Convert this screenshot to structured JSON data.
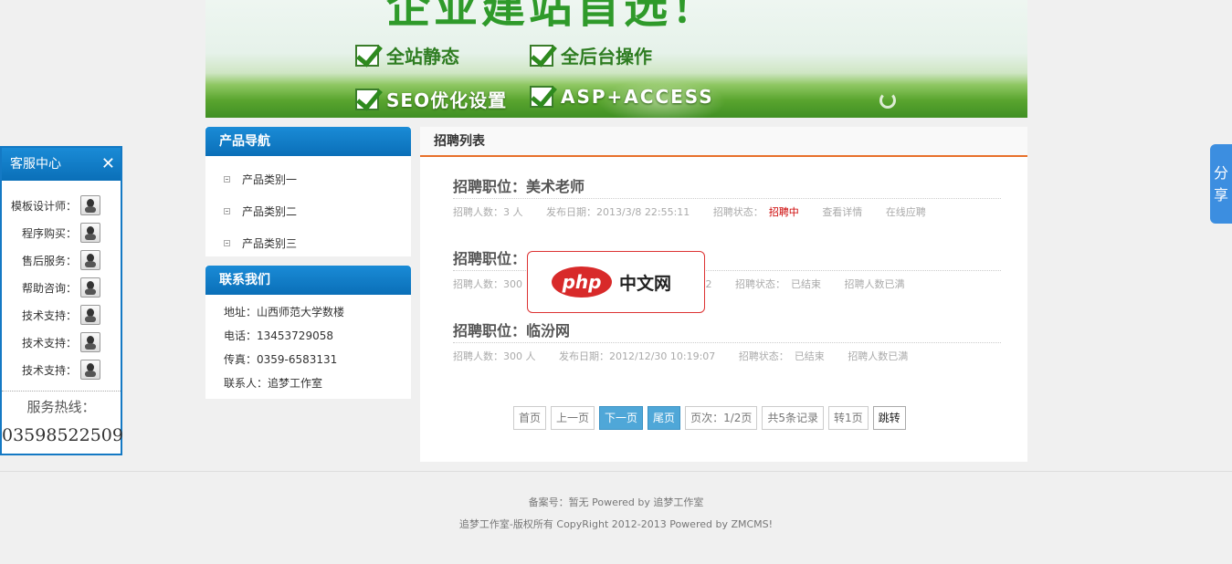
{
  "banner": {
    "big_title": "企业建站首选！",
    "features": [
      "全站静态",
      "全后台操作",
      "SEO优化设置",
      "ASP+ACCESS"
    ]
  },
  "nav_panel": {
    "title": "产品导航",
    "items": [
      "产品类别一",
      "产品类别二",
      "产品类别三"
    ]
  },
  "contact_panel": {
    "title": "联系我们",
    "lines": [
      "地址：山西师范大学数楼",
      "电话：13453729058",
      "传真：0359-6583131",
      "联系人：追梦工作室"
    ]
  },
  "main": {
    "title": "招聘列表",
    "jobs": [
      {
        "title": "招聘职位：美术老师",
        "count": "招聘人数：3 人",
        "date": "发布日期：2013/3/8 22:55:11",
        "status_label": "招聘状态：",
        "status": "招聘中",
        "action1": "查看详情",
        "action2": "在线应聘"
      },
      {
        "title": "招聘职位：",
        "count": "招聘人数：300",
        "date": "42",
        "status_label": "招聘状态：",
        "status": "已结束",
        "action1": "招聘人数已满",
        "action2": ""
      },
      {
        "title": "招聘职位：临汾网",
        "count": "招聘人数：300 人",
        "date": "发布日期：2012/12/30 10:19:07",
        "status_label": "招聘状态：",
        "status": "已结束",
        "action1": "招聘人数已满",
        "action2": ""
      }
    ],
    "pager": {
      "first": "首页",
      "prev": "上一页",
      "next": "下一页",
      "last": "尾页",
      "page_info": "页次：1/2页",
      "total": "共5条记录",
      "jump_to": "转1页",
      "go": "跳转"
    }
  },
  "watermark": {
    "logo": "php",
    "text": "中文网"
  },
  "customer_service": {
    "title": "客服中心",
    "close": "✕",
    "rows": [
      "模板设计师：",
      "程序购买：",
      "售后服务：",
      "帮助咨询：",
      "技术支持：",
      "技术支持：",
      "技术支持："
    ],
    "hotline_label": "服务热线：",
    "hotline_number": "03598522509"
  },
  "share": {
    "label": "分享"
  },
  "footer": {
    "line1": "备案号：暂无 Powered by 追梦工作室",
    "line2": "追梦工作室-版权所有 CopyRight  2012-2013 Powered by ZMCMS!"
  },
  "colors": {
    "primary_blue": "#0a6fb8",
    "accent_orange": "#e8702a",
    "status_red": "#cc0000"
  }
}
